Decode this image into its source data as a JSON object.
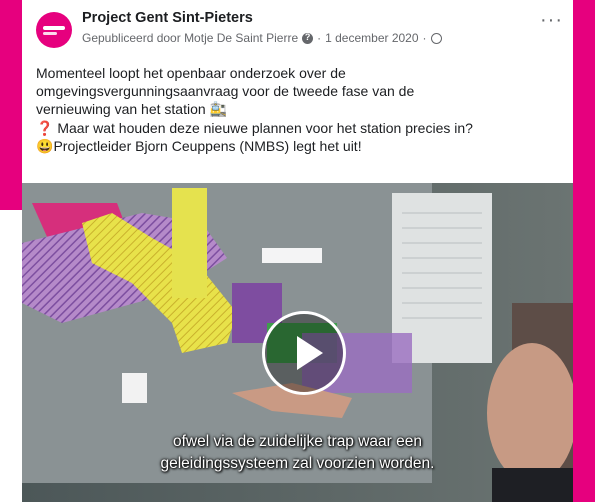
{
  "post": {
    "page_name": "Project Gent Sint-Pieters",
    "meta": {
      "published_by": "Gepubliceerd door Motje De Saint Pierre",
      "separator": "·",
      "date": "1 december 2020",
      "separator2": "·"
    },
    "text_lines": [
      "Momenteel loopt het openbaar onderzoek over de",
      "omgevingsvergunningsaanvraag voor de tweede fase van de",
      "vernieuwing van het station 🚉",
      "Maar wat houden deze nieuwe plannen voor het station precies in?",
      "Projectleider Bjorn Ceuppens (NMBS) legt het uit!"
    ],
    "line4_prefix": "❓",
    "line5_prefix": "😃"
  },
  "video": {
    "subtitle_lines": [
      "ofwel via de zuidelijke trap waar een",
      "geleidingssysteem zal voorzien worden."
    ],
    "play_icon": "play-icon"
  },
  "colors": {
    "brand_magenta": "#e6007e",
    "text_primary": "#1c1e21",
    "text_secondary": "#65676b"
  },
  "icons": {
    "more": "more-options-icon",
    "info": "info-icon",
    "globe": "globe-icon"
  }
}
